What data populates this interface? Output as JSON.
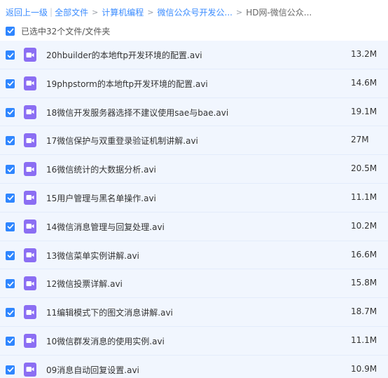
{
  "breadcrumb": {
    "back": "返回上一级",
    "all_files": "全部文件",
    "level1": "计算机编程",
    "level2": "微信公众号开发公...",
    "current": "HD网-微信公众..."
  },
  "selection": {
    "label": "已选中32个文件/文件夹",
    "checked": true
  },
  "files": [
    {
      "name": "20hbuilder的本地ftp开发环境的配置.avi",
      "size": "13.2M",
      "checked": true
    },
    {
      "name": "19phpstorm的本地ftp开发环境的配置.avi",
      "size": "14.6M",
      "checked": true
    },
    {
      "name": "18微信开发服务器选择不建议使用sae与bae.avi",
      "size": "19.1M",
      "checked": true
    },
    {
      "name": "17微信保护与双重登录验证机制讲解.avi",
      "size": "27M",
      "checked": true
    },
    {
      "name": "16微信统计的大数据分析.avi",
      "size": "20.5M",
      "checked": true
    },
    {
      "name": "15用户管理与黑名单操作.avi",
      "size": "11.1M",
      "checked": true
    },
    {
      "name": "14微信消息管理与回复处理.avi",
      "size": "10.2M",
      "checked": true
    },
    {
      "name": "13微信菜单实例讲解.avi",
      "size": "16.6M",
      "checked": true
    },
    {
      "name": "12微信投票详解.avi",
      "size": "15.8M",
      "checked": true
    },
    {
      "name": "11编辑模式下的图文消息讲解.avi",
      "size": "18.7M",
      "checked": true
    },
    {
      "name": "10微信群发消息的使用实例.avi",
      "size": "11.1M",
      "checked": true
    },
    {
      "name": "09消息自动回复设置.avi",
      "size": "10.9M",
      "checked": true
    }
  ],
  "icons": {
    "checkbox": "checkmark-icon",
    "file": "video-file-icon"
  },
  "colors": {
    "link": "#3b8cff",
    "checkbox": "#2f86ff",
    "row_bg": "#f1f6fe",
    "video_icon": "#8b6ef3"
  }
}
